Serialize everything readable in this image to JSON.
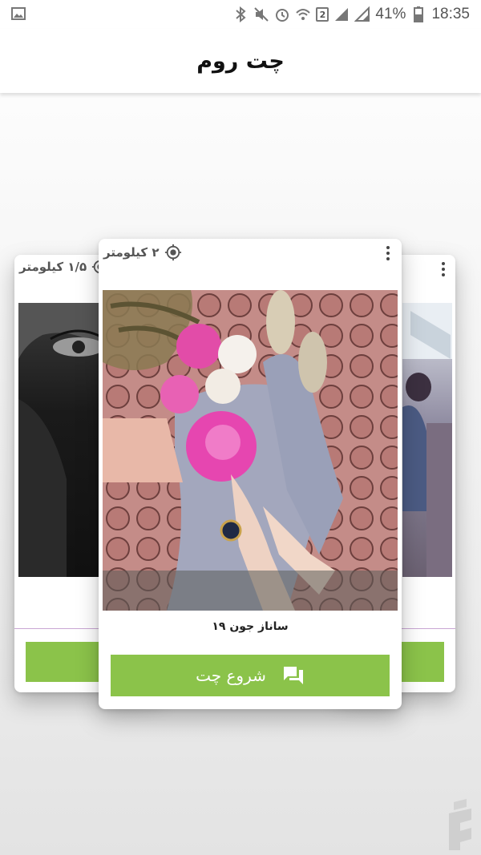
{
  "status_bar": {
    "battery_percent": "41%",
    "time": "18:35",
    "sim_number": "2"
  },
  "app_bar": {
    "title": "چت روم"
  },
  "cards": {
    "left": {
      "distance": "۱/۵ کیلومتر"
    },
    "center": {
      "distance": "۲ کیلومتر",
      "name": "ساناز جون ۱۹",
      "button_label": "شروع چت"
    }
  },
  "colors": {
    "accent_green": "#8bc34a",
    "divider_purple": "#c9a6d3"
  }
}
